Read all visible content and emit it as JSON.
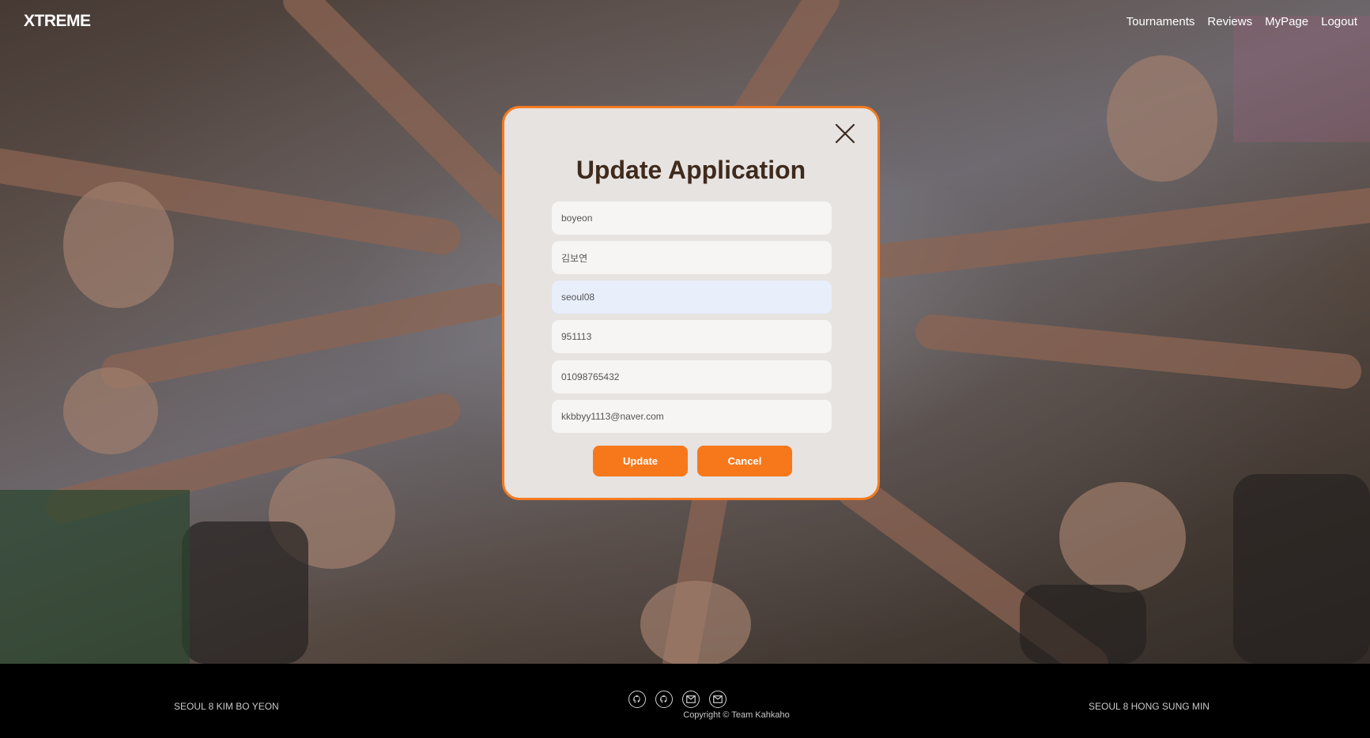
{
  "header": {
    "logo": "XTREME",
    "nav": [
      {
        "label": "Tournaments"
      },
      {
        "label": "Reviews"
      },
      {
        "label": "MyPage"
      },
      {
        "label": "Logout"
      }
    ]
  },
  "modal": {
    "title": "Update Application",
    "fields": [
      {
        "value": "boyeon"
      },
      {
        "value": "김보연"
      },
      {
        "value": "seoul08"
      },
      {
        "value": "951113"
      },
      {
        "value": "01098765432"
      },
      {
        "value": "kkbbyy1113@naver.com"
      }
    ],
    "update_label": "Update",
    "cancel_label": "Cancel"
  },
  "footer": {
    "left_credit": "SEOUL 8 KIM BO YEON",
    "right_credit": "SEOUL 8 HONG SUNG MIN",
    "copyright": "Copyright © Team Kahkaho",
    "icons": [
      "github-icon",
      "github-icon",
      "mail-icon",
      "mail-icon"
    ]
  },
  "colors": {
    "accent": "#f7781b",
    "modal_bg": "#e6e3e1",
    "title": "#3f2a1c"
  }
}
